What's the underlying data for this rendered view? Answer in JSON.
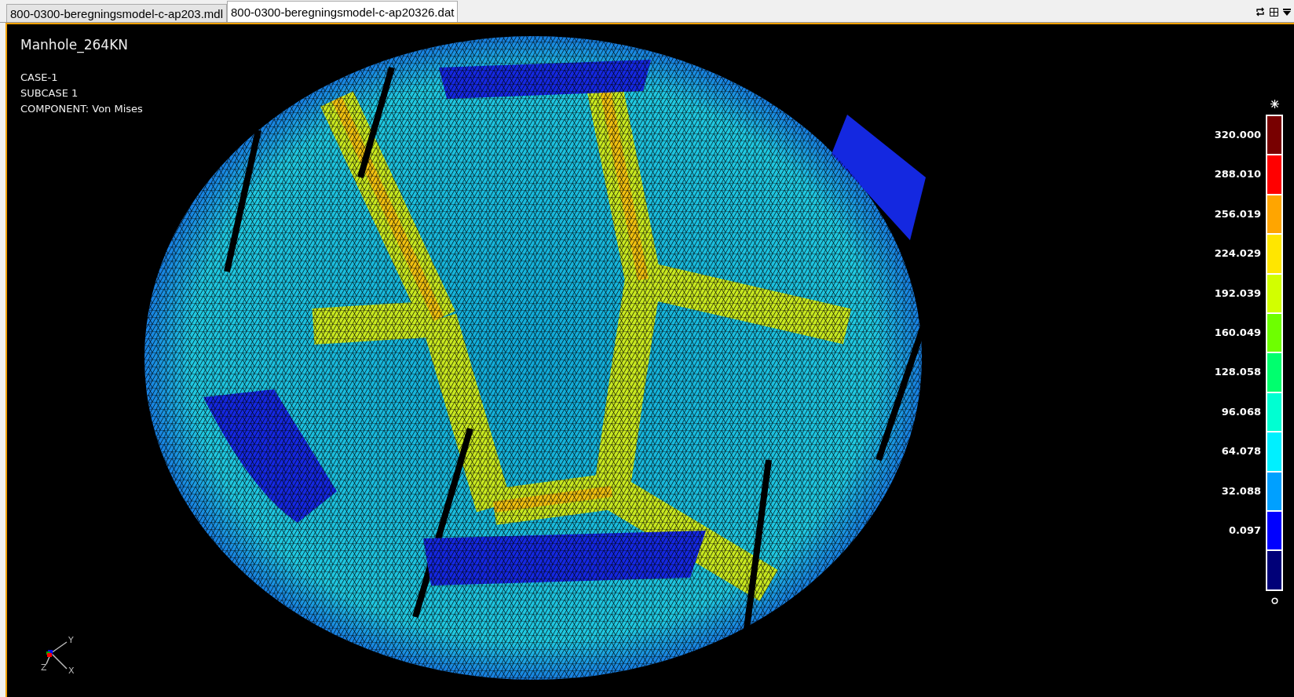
{
  "tabs": [
    {
      "label": "800-0300-beregningsmodel-c-ap203.mdl",
      "selected": false
    },
    {
      "label": "800-0300-beregningsmodel-c-ap20326.dat",
      "selected": true
    }
  ],
  "viewport": {
    "title": "Manhole_264KN",
    "info": [
      "CASE-1",
      "SUBCASE 1",
      "COMPONENT: Von Mises"
    ],
    "legend": {
      "bands": [
        {
          "color": "#780000"
        },
        {
          "color": "#ff0000"
        },
        {
          "color": "#ffa500"
        },
        {
          "color": "#ffe600"
        },
        {
          "color": "#d2ff00"
        },
        {
          "color": "#6eff00"
        },
        {
          "color": "#00ff6e"
        },
        {
          "color": "#00ffd2"
        },
        {
          "color": "#00f0ff"
        },
        {
          "color": "#00a0ff"
        },
        {
          "color": "#0000ff"
        },
        {
          "color": "#000078"
        }
      ],
      "labels": [
        "320.000",
        "288.010",
        "256.019",
        "224.029",
        "192.039",
        "160.049",
        "128.058",
        "96.068",
        "64.078",
        "32.088",
        "0.097"
      ]
    },
    "triad": {
      "x": "X",
      "y": "Y",
      "z": "Z"
    }
  }
}
